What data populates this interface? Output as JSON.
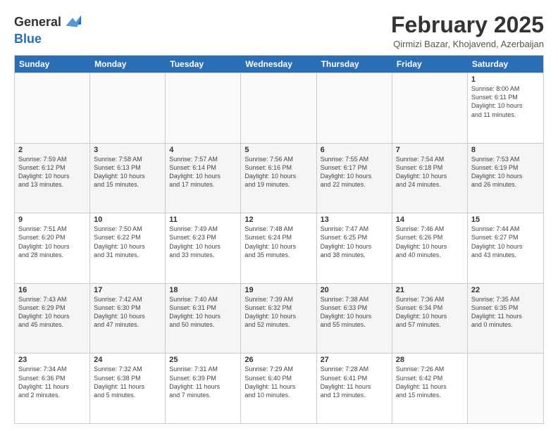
{
  "header": {
    "logo_line1": "General",
    "logo_line2": "Blue",
    "month_title": "February 2025",
    "location": "Qirmizi Bazar, Khojavend, Azerbaijan"
  },
  "weekdays": [
    "Sunday",
    "Monday",
    "Tuesday",
    "Wednesday",
    "Thursday",
    "Friday",
    "Saturday"
  ],
  "rows": [
    [
      {
        "day": "",
        "info": ""
      },
      {
        "day": "",
        "info": ""
      },
      {
        "day": "",
        "info": ""
      },
      {
        "day": "",
        "info": ""
      },
      {
        "day": "",
        "info": ""
      },
      {
        "day": "",
        "info": ""
      },
      {
        "day": "1",
        "info": "Sunrise: 8:00 AM\nSunset: 6:11 PM\nDaylight: 10 hours\nand 11 minutes."
      }
    ],
    [
      {
        "day": "2",
        "info": "Sunrise: 7:59 AM\nSunset: 6:12 PM\nDaylight: 10 hours\nand 13 minutes."
      },
      {
        "day": "3",
        "info": "Sunrise: 7:58 AM\nSunset: 6:13 PM\nDaylight: 10 hours\nand 15 minutes."
      },
      {
        "day": "4",
        "info": "Sunrise: 7:57 AM\nSunset: 6:14 PM\nDaylight: 10 hours\nand 17 minutes."
      },
      {
        "day": "5",
        "info": "Sunrise: 7:56 AM\nSunset: 6:16 PM\nDaylight: 10 hours\nand 19 minutes."
      },
      {
        "day": "6",
        "info": "Sunrise: 7:55 AM\nSunset: 6:17 PM\nDaylight: 10 hours\nand 22 minutes."
      },
      {
        "day": "7",
        "info": "Sunrise: 7:54 AM\nSunset: 6:18 PM\nDaylight: 10 hours\nand 24 minutes."
      },
      {
        "day": "8",
        "info": "Sunrise: 7:53 AM\nSunset: 6:19 PM\nDaylight: 10 hours\nand 26 minutes."
      }
    ],
    [
      {
        "day": "9",
        "info": "Sunrise: 7:51 AM\nSunset: 6:20 PM\nDaylight: 10 hours\nand 28 minutes."
      },
      {
        "day": "10",
        "info": "Sunrise: 7:50 AM\nSunset: 6:22 PM\nDaylight: 10 hours\nand 31 minutes."
      },
      {
        "day": "11",
        "info": "Sunrise: 7:49 AM\nSunset: 6:23 PM\nDaylight: 10 hours\nand 33 minutes."
      },
      {
        "day": "12",
        "info": "Sunrise: 7:48 AM\nSunset: 6:24 PM\nDaylight: 10 hours\nand 35 minutes."
      },
      {
        "day": "13",
        "info": "Sunrise: 7:47 AM\nSunset: 6:25 PM\nDaylight: 10 hours\nand 38 minutes."
      },
      {
        "day": "14",
        "info": "Sunrise: 7:46 AM\nSunset: 6:26 PM\nDaylight: 10 hours\nand 40 minutes."
      },
      {
        "day": "15",
        "info": "Sunrise: 7:44 AM\nSunset: 6:27 PM\nDaylight: 10 hours\nand 43 minutes."
      }
    ],
    [
      {
        "day": "16",
        "info": "Sunrise: 7:43 AM\nSunset: 6:29 PM\nDaylight: 10 hours\nand 45 minutes."
      },
      {
        "day": "17",
        "info": "Sunrise: 7:42 AM\nSunset: 6:30 PM\nDaylight: 10 hours\nand 47 minutes."
      },
      {
        "day": "18",
        "info": "Sunrise: 7:40 AM\nSunset: 6:31 PM\nDaylight: 10 hours\nand 50 minutes."
      },
      {
        "day": "19",
        "info": "Sunrise: 7:39 AM\nSunset: 6:32 PM\nDaylight: 10 hours\nand 52 minutes."
      },
      {
        "day": "20",
        "info": "Sunrise: 7:38 AM\nSunset: 6:33 PM\nDaylight: 10 hours\nand 55 minutes."
      },
      {
        "day": "21",
        "info": "Sunrise: 7:36 AM\nSunset: 6:34 PM\nDaylight: 10 hours\nand 57 minutes."
      },
      {
        "day": "22",
        "info": "Sunrise: 7:35 AM\nSunset: 6:35 PM\nDaylight: 11 hours\nand 0 minutes."
      }
    ],
    [
      {
        "day": "23",
        "info": "Sunrise: 7:34 AM\nSunset: 6:36 PM\nDaylight: 11 hours\nand 2 minutes."
      },
      {
        "day": "24",
        "info": "Sunrise: 7:32 AM\nSunset: 6:38 PM\nDaylight: 11 hours\nand 5 minutes."
      },
      {
        "day": "25",
        "info": "Sunrise: 7:31 AM\nSunset: 6:39 PM\nDaylight: 11 hours\nand 7 minutes."
      },
      {
        "day": "26",
        "info": "Sunrise: 7:29 AM\nSunset: 6:40 PM\nDaylight: 11 hours\nand 10 minutes."
      },
      {
        "day": "27",
        "info": "Sunrise: 7:28 AM\nSunset: 6:41 PM\nDaylight: 11 hours\nand 13 minutes."
      },
      {
        "day": "28",
        "info": "Sunrise: 7:26 AM\nSunset: 6:42 PM\nDaylight: 11 hours\nand 15 minutes."
      },
      {
        "day": "",
        "info": ""
      }
    ]
  ]
}
